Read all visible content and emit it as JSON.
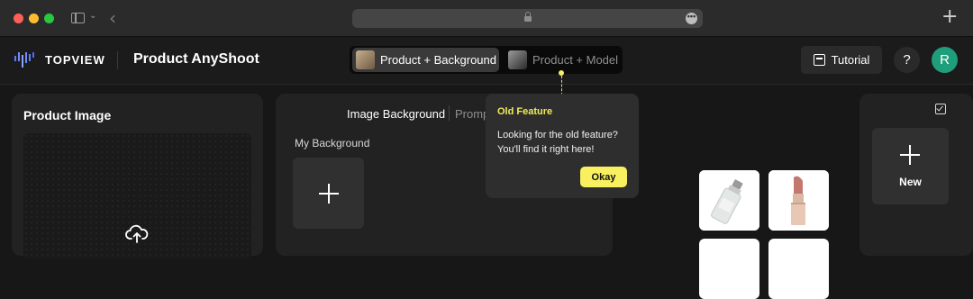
{
  "browser": {
    "url_more_label": "•••"
  },
  "header": {
    "brand": "TOPVIEW",
    "title": "Product AnyShoot",
    "modes": [
      {
        "label": "Product + Background",
        "active": true
      },
      {
        "label": "Product + Model",
        "active": false
      }
    ],
    "tutorial_label": "Tutorial",
    "help_label": "?",
    "avatar_initial": "R",
    "accent_color": "#1f9e7c"
  },
  "product_panel": {
    "title": "Product Image"
  },
  "background_panel": {
    "tabs": [
      "Image Background",
      "Promp"
    ],
    "my_background_label": "My Background"
  },
  "tooltip": {
    "title": "Old Feature",
    "body": "Looking for the old feature? You'll find it right here!",
    "button_label": "Okay",
    "accent_color": "#f8f05e"
  },
  "right_panel": {
    "new_label": "New"
  },
  "icons": [
    "sidebar-icon",
    "chevron-down-icon",
    "back-icon",
    "lock-icon",
    "more-icon",
    "plus-icon",
    "calendar-icon",
    "upload-cloud-icon",
    "checkbox-icon"
  ]
}
